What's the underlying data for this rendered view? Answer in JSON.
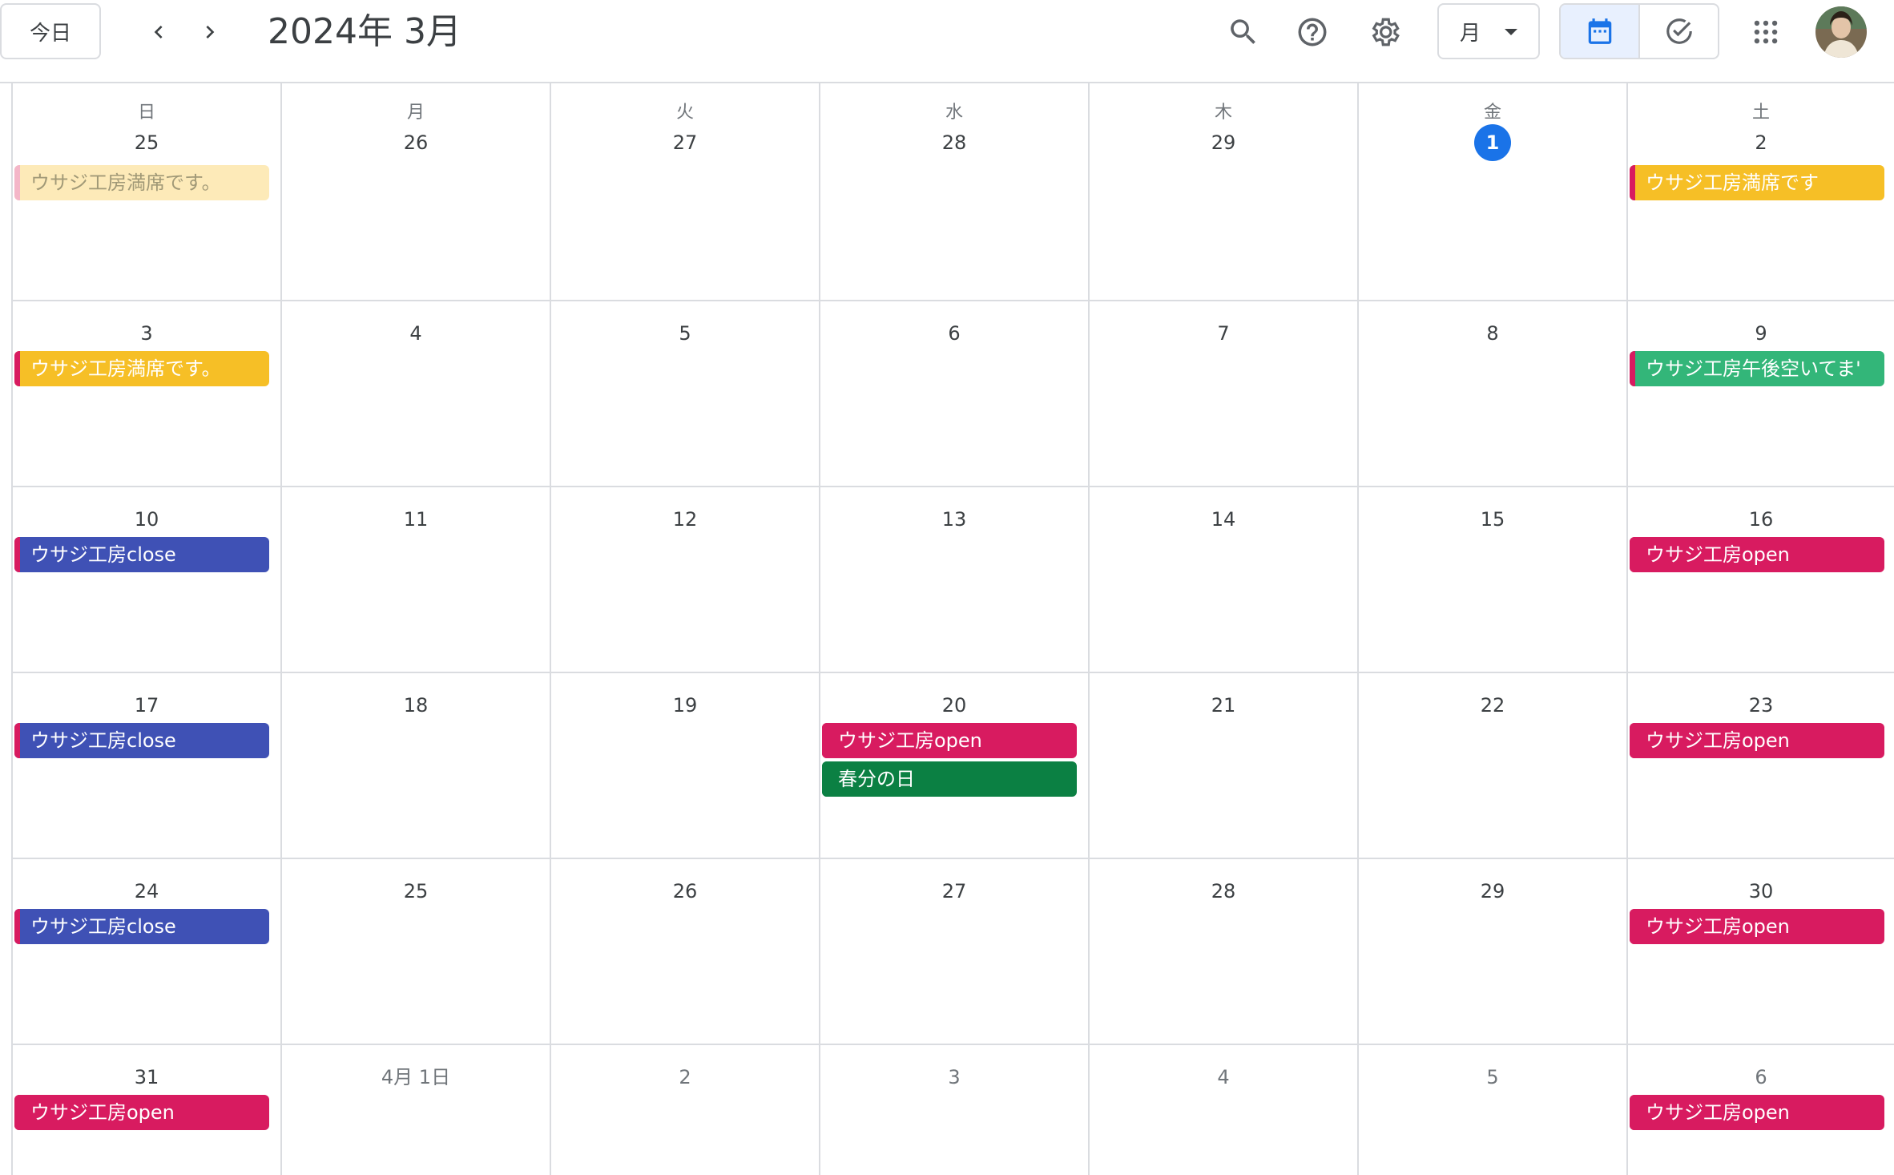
{
  "header": {
    "today_label": "今日",
    "month_title": "2024年 3月",
    "view_label": "月"
  },
  "colors": {
    "yellow": "#f6bf26",
    "yellow_faded": "#fdeab8",
    "pink": "#d81b60",
    "pink_light": "#f4b6c8",
    "green_teal": "#33b679",
    "indigo": "#3f51b5",
    "green_holiday": "#0b8043",
    "today_blue": "#1a73e8"
  },
  "weekdays": [
    "日",
    "月",
    "火",
    "水",
    "木",
    "金",
    "土"
  ],
  "weeks": [
    {
      "days": [
        {
          "label": "25",
          "muted": false
        },
        {
          "label": "26",
          "muted": false
        },
        {
          "label": "27",
          "muted": false
        },
        {
          "label": "28",
          "muted": false
        },
        {
          "label": "29",
          "muted": false
        },
        {
          "label": "1",
          "today": true
        },
        {
          "label": "2",
          "muted": false
        }
      ],
      "events": [
        {
          "day": 0,
          "slot": 0,
          "title": "ウサジ工房満席です。",
          "bg": "yellow_faded",
          "stripe": "pink_light",
          "faded": true
        },
        {
          "day": 6,
          "slot": 0,
          "title": "ウサジ工房満席です",
          "bg": "yellow",
          "stripe": "pink"
        }
      ]
    },
    {
      "days": [
        {
          "label": "3"
        },
        {
          "label": "4"
        },
        {
          "label": "5"
        },
        {
          "label": "6"
        },
        {
          "label": "7"
        },
        {
          "label": "8"
        },
        {
          "label": "9"
        }
      ],
      "events": [
        {
          "day": 0,
          "slot": 0,
          "title": "ウサジ工房満席です。",
          "bg": "yellow",
          "stripe": "pink"
        },
        {
          "day": 6,
          "slot": 0,
          "title": "ウサジ工房午後空いてま'",
          "bg": "green_teal",
          "stripe": "pink"
        }
      ]
    },
    {
      "days": [
        {
          "label": "10"
        },
        {
          "label": "11"
        },
        {
          "label": "12"
        },
        {
          "label": "13"
        },
        {
          "label": "14"
        },
        {
          "label": "15"
        },
        {
          "label": "16"
        }
      ],
      "events": [
        {
          "day": 0,
          "slot": 0,
          "title": "ウサジ工房close",
          "bg": "indigo",
          "stripe": "pink"
        },
        {
          "day": 6,
          "slot": 0,
          "title": "ウサジ工房open",
          "bg": "pink",
          "stripe": "pink"
        }
      ]
    },
    {
      "days": [
        {
          "label": "17"
        },
        {
          "label": "18"
        },
        {
          "label": "19"
        },
        {
          "label": "20"
        },
        {
          "label": "21"
        },
        {
          "label": "22"
        },
        {
          "label": "23"
        }
      ],
      "events": [
        {
          "day": 0,
          "slot": 0,
          "title": "ウサジ工房close",
          "bg": "indigo",
          "stripe": "pink"
        },
        {
          "day": 3,
          "slot": 0,
          "title": "ウサジ工房open",
          "bg": "pink",
          "stripe": "pink"
        },
        {
          "day": 3,
          "slot": 1,
          "title": "春分の日",
          "bg": "green_holiday",
          "stripe": "green_holiday"
        },
        {
          "day": 6,
          "slot": 0,
          "title": "ウサジ工房open",
          "bg": "pink",
          "stripe": "pink"
        }
      ]
    },
    {
      "days": [
        {
          "label": "24"
        },
        {
          "label": "25"
        },
        {
          "label": "26"
        },
        {
          "label": "27"
        },
        {
          "label": "28"
        },
        {
          "label": "29"
        },
        {
          "label": "30"
        }
      ],
      "events": [
        {
          "day": 0,
          "slot": 0,
          "title": "ウサジ工房close",
          "bg": "indigo",
          "stripe": "pink"
        },
        {
          "day": 6,
          "slot": 0,
          "title": "ウサジ工房open",
          "bg": "pink",
          "stripe": "pink"
        }
      ]
    },
    {
      "days": [
        {
          "label": "31"
        },
        {
          "label": "4月 1日",
          "muted": true
        },
        {
          "label": "2",
          "muted": true
        },
        {
          "label": "3",
          "muted": true
        },
        {
          "label": "4",
          "muted": true
        },
        {
          "label": "5",
          "muted": true
        },
        {
          "label": "6",
          "muted": true
        }
      ],
      "events": [
        {
          "day": 0,
          "slot": 0,
          "title": "ウサジ工房open",
          "bg": "pink",
          "stripe": "pink"
        },
        {
          "day": 6,
          "slot": 0,
          "title": "ウサジ工房open",
          "bg": "pink",
          "stripe": "pink"
        }
      ]
    }
  ]
}
